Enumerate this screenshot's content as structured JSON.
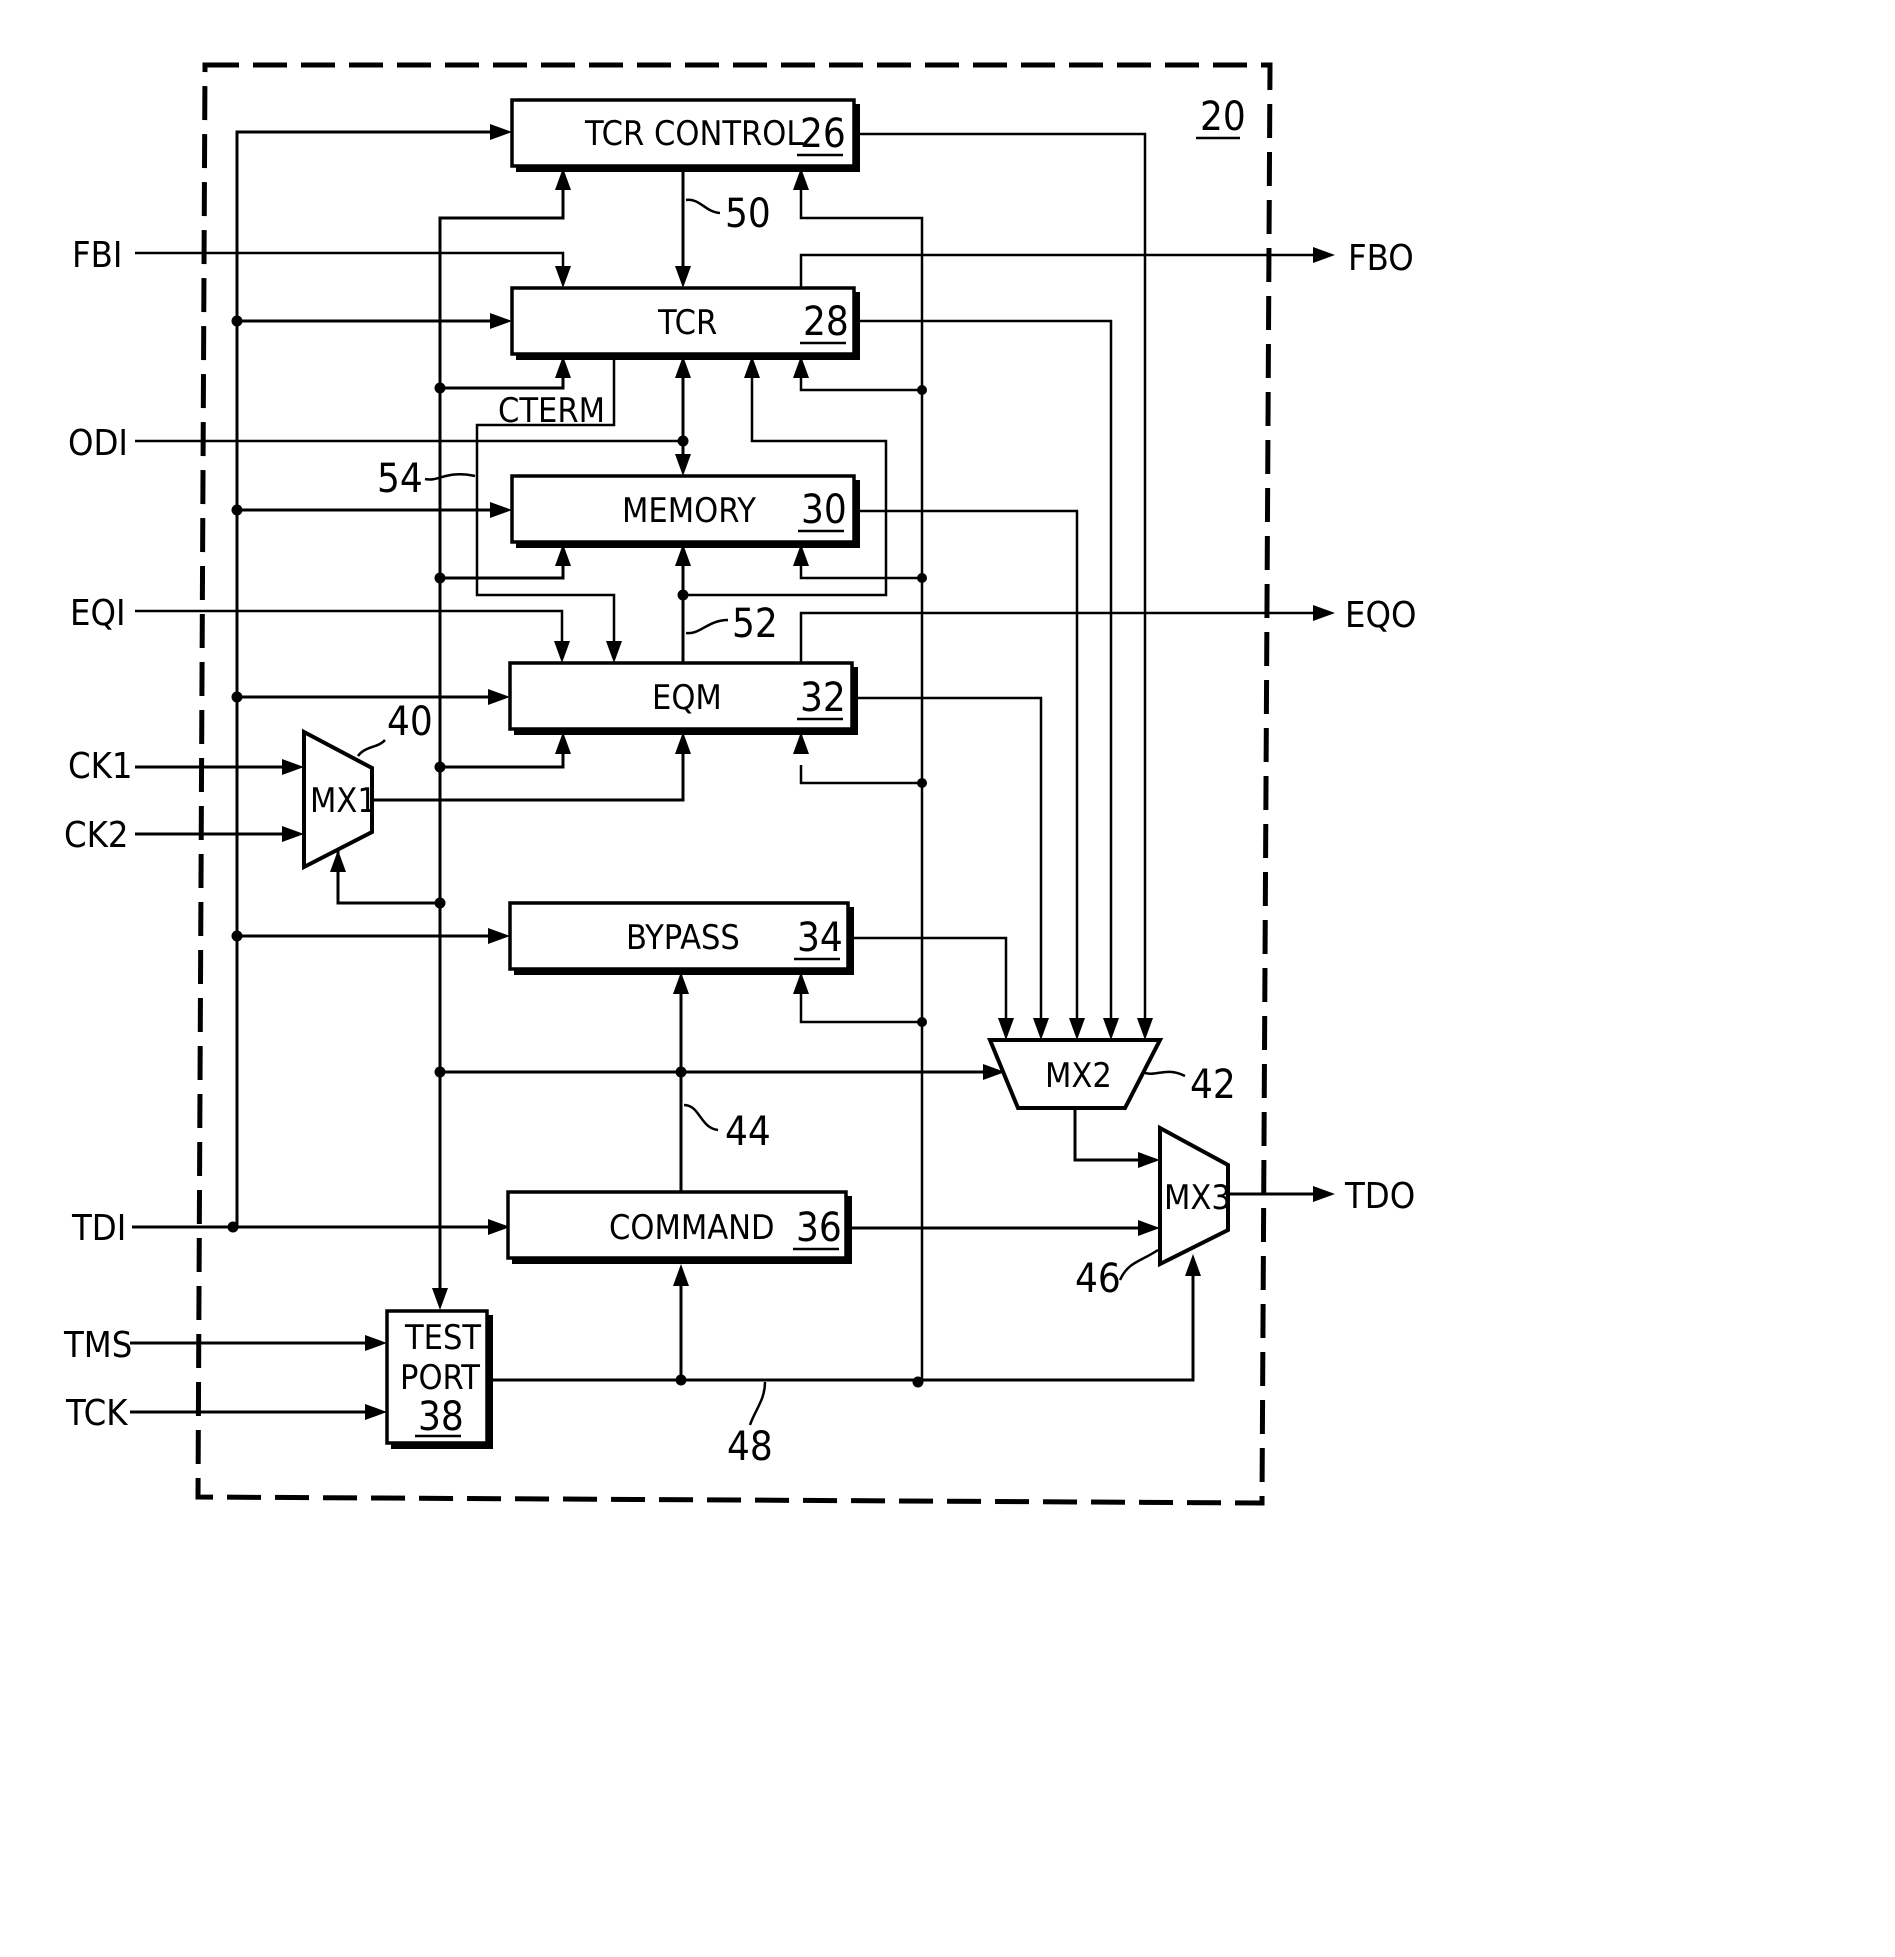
{
  "figure": {
    "reference_number": "20",
    "colors": {
      "ink": "#000000",
      "paper": "#ffffff"
    }
  },
  "inputs": [
    {
      "id": "fbi",
      "label": "FBI"
    },
    {
      "id": "odi",
      "label": "ODI"
    },
    {
      "id": "eqi",
      "label": "EQI"
    },
    {
      "id": "ck1",
      "label": "CK1"
    },
    {
      "id": "ck2",
      "label": "CK2"
    },
    {
      "id": "tdi",
      "label": "TDI"
    },
    {
      "id": "tms",
      "label": "TMS"
    },
    {
      "id": "tck",
      "label": "TCK"
    }
  ],
  "outputs": [
    {
      "id": "fbo",
      "label": "FBO"
    },
    {
      "id": "eqo",
      "label": "EQO"
    },
    {
      "id": "tdo",
      "label": "TDO"
    }
  ],
  "blocks": {
    "tcr_control": {
      "label": "TCR CONTROL",
      "ref": "26"
    },
    "tcr": {
      "label": "TCR",
      "ref": "28"
    },
    "memory": {
      "label": "MEMORY",
      "ref": "30"
    },
    "eqm": {
      "label": "EQM",
      "ref": "32"
    },
    "bypass": {
      "label": "BYPASS",
      "ref": "34"
    },
    "command": {
      "label": "COMMAND",
      "ref": "36"
    },
    "test_port": {
      "label_line1": "TEST",
      "label_line2": "PORT",
      "ref": "38"
    }
  },
  "muxes": {
    "mx1": {
      "label": "MX1",
      "ref": "40"
    },
    "mx2": {
      "label": "MX2",
      "ref": "42"
    },
    "mx3": {
      "label": "MX3",
      "ref": "46"
    }
  },
  "signals": {
    "cterm": "CTERM",
    "bus_50": "50",
    "bus_52": "52",
    "bus_54": "54",
    "bus_44": "44",
    "bus_48": "48"
  }
}
